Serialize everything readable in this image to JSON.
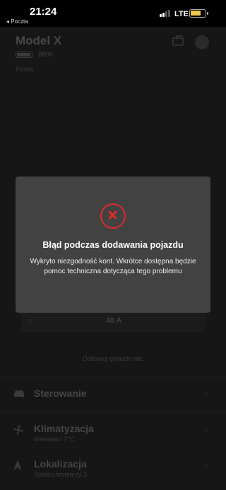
{
  "status_bar": {
    "time": "21:24",
    "back_label": "◂ Poczta",
    "network": "LTE",
    "signal_bars": 2,
    "battery_level": 0.6,
    "battery_color": "#f2c94c"
  },
  "vehicle": {
    "name": "Model X",
    "battery_percent": "89%",
    "status": "Postój"
  },
  "header_icons": [
    "toolbox-icon",
    "profile-icon"
  ],
  "charging": {
    "amp_value": "48 A",
    "unlock_text": "Odblokuj gniazdo ład."
  },
  "menu": {
    "items": [
      {
        "label": "Sterowanie",
        "subtitle": "",
        "icon": "car-icon"
      },
      {
        "label": "Klimatyzacja",
        "subtitle": "Wewnątrz 7°C",
        "icon": "fan-icon"
      },
      {
        "label": "Lokalizacja",
        "subtitle": "Spadochroniarzy 3",
        "icon": "navigation-icon"
      }
    ]
  },
  "modal": {
    "title": "Błąd podczas dodawania pojazdu",
    "message": "Wykryto niezgodność kont. Wkrótce dostępna będzie pomoc techniczna dotycząca tego problemu",
    "accent_color": "#e02a2a"
  }
}
